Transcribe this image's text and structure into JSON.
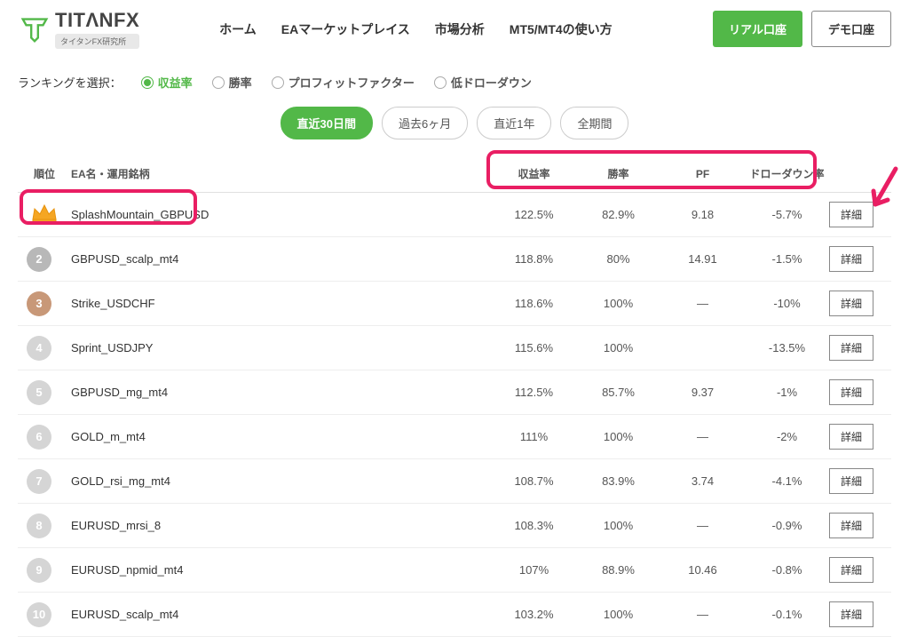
{
  "header": {
    "logo_text": "TITΛNFX",
    "logo_sub": "タイタンFX研究所",
    "nav": [
      "ホーム",
      "EAマーケットプレイス",
      "市場分析",
      "MT5/MT4の使い方"
    ],
    "btn_primary": "リアル口座",
    "btn_secondary": "デモ口座"
  },
  "filter": {
    "label": "ランキングを選択：",
    "options": [
      "収益率",
      "勝率",
      "プロフィットファクター",
      "低ドローダウン"
    ],
    "selected": 0
  },
  "periods": {
    "options": [
      "直近30日間",
      "過去6ヶ月",
      "直近1年",
      "全期間"
    ],
    "active": 0
  },
  "table": {
    "headers": {
      "rank": "順位",
      "name": "EA名・運用銘柄",
      "profit": "収益率",
      "winrate": "勝率",
      "pf": "PF",
      "drawdown": "ドローダウン率"
    },
    "detail_label": "詳細",
    "rows": [
      {
        "rank": 1,
        "name": "SplashMountain_GBPUSD",
        "profit": "122.5%",
        "winrate": "82.9%",
        "pf": "9.18",
        "drawdown": "-5.7%"
      },
      {
        "rank": 2,
        "name": "GBPUSD_scalp_mt4",
        "profit": "118.8%",
        "winrate": "80%",
        "pf": "14.91",
        "drawdown": "-1.5%"
      },
      {
        "rank": 3,
        "name": "Strike_USDCHF",
        "profit": "118.6%",
        "winrate": "100%",
        "pf": "—",
        "drawdown": "-10%"
      },
      {
        "rank": 4,
        "name": "Sprint_USDJPY",
        "profit": "115.6%",
        "winrate": "100%",
        "pf": "",
        "drawdown": "-13.5%"
      },
      {
        "rank": 5,
        "name": "GBPUSD_mg_mt4",
        "profit": "112.5%",
        "winrate": "85.7%",
        "pf": "9.37",
        "drawdown": "-1%"
      },
      {
        "rank": 6,
        "name": "GOLD_m_mt4",
        "profit": "111%",
        "winrate": "100%",
        "pf": "—",
        "drawdown": "-2%"
      },
      {
        "rank": 7,
        "name": "GOLD_rsi_mg_mt4",
        "profit": "108.7%",
        "winrate": "83.9%",
        "pf": "3.74",
        "drawdown": "-4.1%"
      },
      {
        "rank": 8,
        "name": "EURUSD_mrsi_8",
        "profit": "108.3%",
        "winrate": "100%",
        "pf": "—",
        "drawdown": "-0.9%"
      },
      {
        "rank": 9,
        "name": "EURUSD_npmid_mt4",
        "profit": "107%",
        "winrate": "88.9%",
        "pf": "10.46",
        "drawdown": "-0.8%"
      },
      {
        "rank": 10,
        "name": "EURUSD_scalp_mt4",
        "profit": "103.2%",
        "winrate": "100%",
        "pf": "—",
        "drawdown": "-0.1%"
      }
    ]
  }
}
